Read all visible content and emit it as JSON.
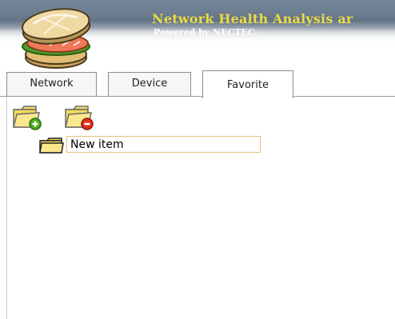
{
  "header": {
    "title": "Network Health Analysis ar",
    "subtitle": "Powered by NECTEC.",
    "logo_icon": "sandwich-logo-icon",
    "title_color": "#eadb44"
  },
  "tabs": [
    {
      "label": "Network",
      "active": false
    },
    {
      "label": "Device",
      "active": false
    },
    {
      "label": "Favorite",
      "active": true
    }
  ],
  "toolbar": {
    "add_icon": "folder-add-icon",
    "remove_icon": "folder-remove-icon"
  },
  "tree": {
    "items": [
      {
        "icon": "folder-icon",
        "value": "New item",
        "editing": true
      }
    ]
  },
  "colors": {
    "header_gray": "#6d7d90",
    "folder_yellow": "#f3d95a",
    "add_green": "#4caf1f",
    "remove_red": "#e0301e",
    "edit_border": "#e7be7a"
  }
}
